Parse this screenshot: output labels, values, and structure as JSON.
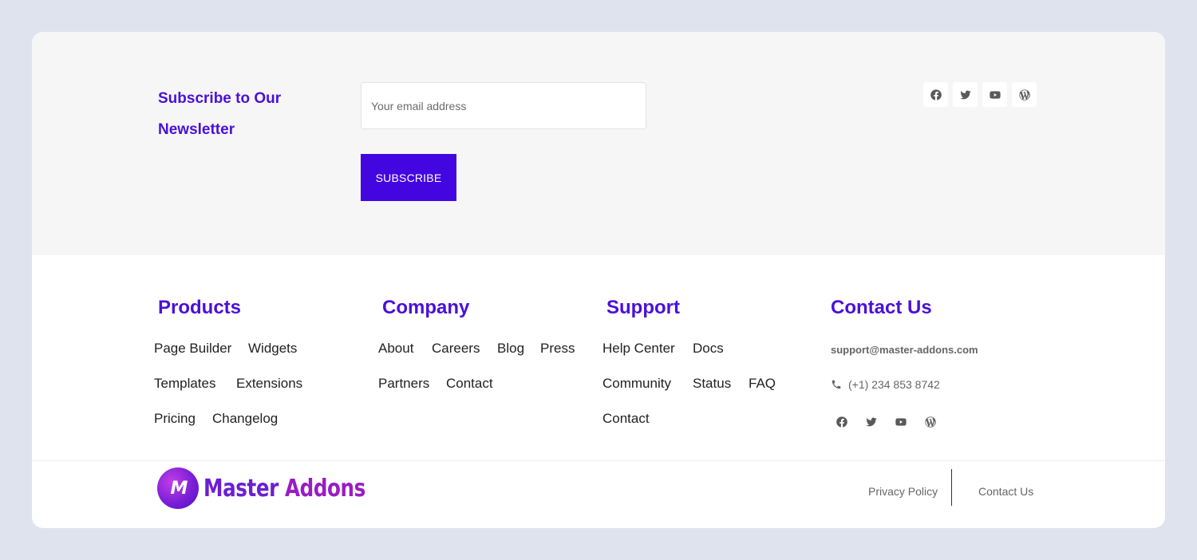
{
  "newsletter": {
    "title": "Subscribe to Our Newsletter",
    "email_placeholder": "Your email address",
    "subscribe_label": "SUBSCRIBE",
    "social": [
      "facebook-icon",
      "twitter-icon",
      "youtube-icon",
      "wordpress-icon"
    ]
  },
  "columns": {
    "products": {
      "title": "Products",
      "links": [
        "Page Builder",
        "Widgets",
        "Templates",
        "Extensions",
        "Pricing",
        "Changelog"
      ]
    },
    "company": {
      "title": "Company",
      "links": [
        "About",
        "Careers",
        "Blog",
        "Press",
        "Partners",
        "Contact"
      ]
    },
    "support": {
      "title": "Support",
      "links": [
        "Help Center",
        "Docs",
        "Community",
        "Status",
        "FAQ",
        "Contact"
      ]
    },
    "contact": {
      "title": "Contact Us",
      "email": "support@master-addons.com",
      "phone": "(+1) 234 853 8742",
      "social": [
        "facebook-icon",
        "twitter-icon",
        "youtube-icon",
        "wordpress-icon"
      ]
    }
  },
  "bottom": {
    "logo_mark": "M",
    "logo_word1": "Master",
    "logo_word2": "Addons",
    "privacy_label": "Privacy Policy",
    "contact_label": "Contact Us"
  },
  "colors": {
    "accent": "#4a10d9",
    "button": "#4306e0",
    "page_bg": "#dfe3ed",
    "newsletter_bg": "#f6f6f7"
  }
}
